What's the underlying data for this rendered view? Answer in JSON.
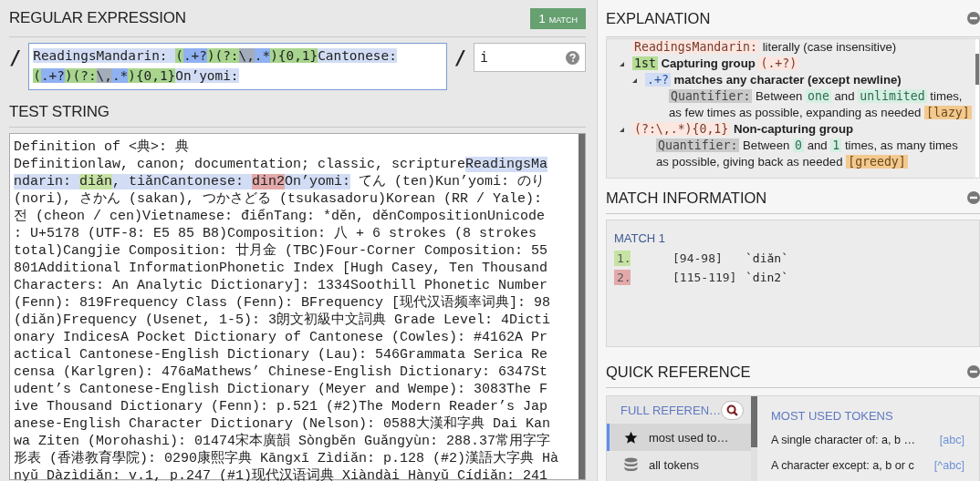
{
  "regex_panel": {
    "title": "REGULAR EXPRESSION",
    "match_badge": {
      "count": "1",
      "label": "MATCH"
    },
    "delimiter_open": "/",
    "delimiter_close": "/",
    "expression_lines": [
      [
        {
          "text": "ReadingsMandarin: ",
          "kind": "literal"
        },
        {
          "text": "(",
          "kind": "group"
        },
        {
          "text": ".+?",
          "kind": "token"
        },
        {
          "text": ")(?:",
          "kind": "group"
        },
        {
          "text": "\\,",
          "kind": "escape"
        },
        {
          "text": ".*",
          "kind": "token"
        },
        {
          "text": "){0,1}",
          "kind": "group"
        },
        {
          "text": "Cantonese:",
          "kind": "literal"
        }
      ],
      [
        {
          "text": "(",
          "kind": "group"
        },
        {
          "text": ".+?",
          "kind": "token"
        },
        {
          "text": ")(?:",
          "kind": "group"
        },
        {
          "text": "\\,",
          "kind": "escape"
        },
        {
          "text": ".*",
          "kind": "token"
        },
        {
          "text": "){0,1}",
          "kind": "group"
        },
        {
          "text": "On’yomi:",
          "kind": "literal"
        }
      ]
    ],
    "flags": "i"
  },
  "test_string": {
    "title": "TEST STRING",
    "lines": [
      [
        {
          "text": "Definition of <典>: 典",
          "kind": "plain"
        }
      ],
      [
        {
          "text": "Definitionlaw, canon; documentation; classic, scripture",
          "kind": "plain"
        },
        {
          "text": "ReadingsMa",
          "kind": "match"
        }
      ],
      [
        {
          "text": "ndarin: ",
          "kind": "match"
        },
        {
          "text": "diǎn",
          "kind": "group-1"
        },
        {
          "text": ", tiǎnCantonese: ",
          "kind": "match"
        },
        {
          "text": "din2",
          "kind": "group-2"
        },
        {
          "text": "On’yomi:",
          "kind": "match"
        },
        {
          "text": " てん (ten)Kun’yomi: のり",
          "kind": "plain"
        }
      ],
      [
        {
          "text": "(nori), さかん (sakan), つかさどる (tsukasadoru)Korean (RR / Yale):",
          "kind": "plain"
        }
      ],
      [
        {
          "text": "전 (cheon / cen)Vietnamese: điểnTang: *děn, děnCompositionUnicode",
          "kind": "plain"
        }
      ],
      [
        {
          "text": ": U+5178 (UTF-8: E5 85 B8)Composition: 八 + 6 strokes (8 strokes",
          "kind": "plain"
        }
      ],
      [
        {
          "text": "total)Cangjie Composition: 廿月金 (TBC)Four-Corner Composition: 55",
          "kind": "plain"
        }
      ],
      [
        {
          "text": "801Additional InformationPhonetic Index [Hugh Casey, Ten Thousand",
          "kind": "plain"
        }
      ],
      [
        {
          "text": "Characters: An Analytic Dictionary]: 1334Soothill Phonetic Number",
          "kind": "plain"
        }
      ],
      [
        {
          "text": "(Fenn): 819Frequency Class (Fenn): BFrequency [现代汉语频率词典]: 98",
          "kind": "plain"
        }
      ],
      [
        {
          "text": "(diǎn)Frequency (Usenet, 1-5): 3朗文初級中文詞典 Grade Level: 4Dicti",
          "kind": "plain"
        }
      ],
      [
        {
          "text": "onary IndicesA Pocket Dictionary of Cantonese (Cowles): #4162A Pr",
          "kind": "plain"
        }
      ],
      [
        {
          "text": "actical Cantonese-English Dictionary (Lau): 546Grammata Serica Re",
          "kind": "plain"
        }
      ],
      [
        {
          "text": "censa (Karlgren): 476aMathews’ Chinese-English Dictionary: 6347St",
          "kind": "plain"
        }
      ],
      [
        {
          "text": "udent’s Cantonese-English Dictionary (Meyer and Wempe): 3083The F",
          "kind": "plain"
        }
      ],
      [
        {
          "text": "ive Thousand Dictionary (Fenn): p.521 (#2)The Modern Reader’s Jap",
          "kind": "plain"
        }
      ],
      [
        {
          "text": "anese-English Character Dictionary (Nelson): 0588大漢和字典 Dai Kan",
          "kind": "plain"
        }
      ],
      [
        {
          "text": "wa Ziten (Morohashi): 01474宋本廣韻 Sòngběn Guǎngyùn: 288.37常用字字",
          "kind": "plain"
        }
      ],
      [
        {
          "text": "形表 (香港教育學院): 0290康熙字典 Kāngxī Zìdiǎn: p.128 (#2)漢語大字典 Hà",
          "kind": "plain"
        }
      ],
      [
        {
          "text": "nyǔ Dàzìdiǎn: v.1, p.247 (#1)现代汉语词典 Xiàndài Hànyǔ Cídiǎn: 241",
          "kind": "plain"
        }
      ]
    ]
  },
  "explanation": {
    "title": "EXPLANATION",
    "items": [
      {
        "kind": "node",
        "segments": [
          {
            "text": "ReadingsMandarin:",
            "kind": "code"
          },
          {
            "text": "literally (case insensitive)",
            "kind": "plain"
          }
        ]
      },
      {
        "kind": "node",
        "expanded": true,
        "segments": [
          {
            "text": "1st",
            "kind": "group"
          },
          {
            "text": "Capturing group",
            "kind": "bold"
          },
          {
            "text": "(.+?)",
            "kind": "code"
          }
        ],
        "children": [
          {
            "kind": "node",
            "expanded": true,
            "segments": [
              {
                "text": ".+?",
                "kind": "token"
              },
              {
                "text": "matches any character (except newline)",
                "kind": "bold"
              }
            ],
            "children": [
              {
                "kind": "description",
                "segments": [
                  {
                    "text": "Quantifier:",
                    "kind": "label"
                  },
                  {
                    "text": "Between",
                    "kind": "plain"
                  },
                  {
                    "text": "one",
                    "kind": "value"
                  },
                  {
                    "text": "and",
                    "kind": "plain"
                  },
                  {
                    "text": "unlimited",
                    "kind": "value"
                  },
                  {
                    "text": "times, as few times as possible, expanding as needed",
                    "kind": "plain"
                  },
                  {
                    "text": "[lazy]",
                    "kind": "mode"
                  }
                ]
              }
            ]
          }
        ]
      },
      {
        "kind": "node",
        "expanded": true,
        "segments": [
          {
            "text": "(?:\\,.*){0,1}",
            "kind": "code"
          },
          {
            "text": "Non-capturing group",
            "kind": "bold"
          }
        ],
        "children": [
          {
            "kind": "description",
            "segments": [
              {
                "text": "Quantifier:",
                "kind": "label"
              },
              {
                "text": "Between",
                "kind": "plain"
              },
              {
                "text": "0",
                "kind": "value"
              },
              {
                "text": "and",
                "kind": "plain"
              },
              {
                "text": "1",
                "kind": "value"
              },
              {
                "text": "times, as many times as possible, giving back as needed",
                "kind": "plain"
              },
              {
                "text": "[greedy]",
                "kind": "mode"
              }
            ]
          }
        ]
      }
    ]
  },
  "match_information": {
    "title": "MATCH INFORMATION",
    "match_title": "MATCH 1",
    "groups": [
      {
        "index": "1.",
        "range": "[94-98]",
        "value": "`diǎn`",
        "color": "#c6e3a3"
      },
      {
        "index": "2.",
        "range": "[115-119]",
        "value": "`din2`",
        "color": "#e3a9a9"
      }
    ]
  },
  "quick_reference": {
    "title": "QUICK REFERENCE",
    "full_reference": "FULL REFEREN…",
    "categories": [
      {
        "label": "most used to…",
        "kind": "star",
        "selected": true
      },
      {
        "label": "all tokens",
        "kind": "stack",
        "selected": false
      }
    ],
    "tokens_title": "MOST USED TOKENS",
    "tokens": [
      {
        "description": "A single character of: a, b …",
        "code": "[abc]"
      },
      {
        "description": "A character except: a, b or c",
        "code": "[^abc]"
      }
    ]
  }
}
